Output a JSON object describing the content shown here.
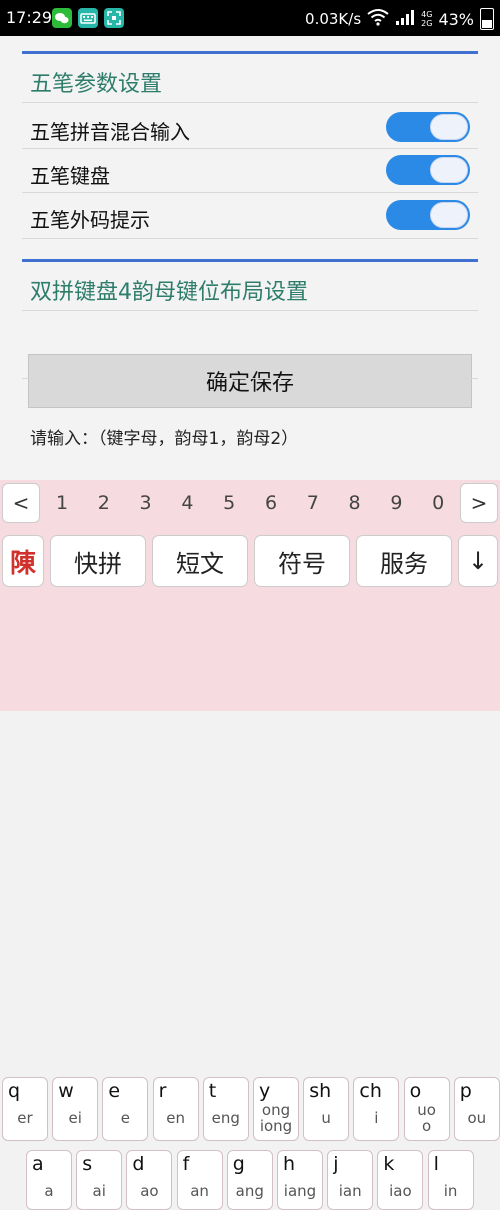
{
  "status_bar": {
    "time": "17:29",
    "speed": "0.03K/s",
    "signal_small": "4G\n2G",
    "battery": "43%",
    "icons": [
      "wechat-icon",
      "keyboard-notify-icon",
      "scan-icon",
      "wifi-icon",
      "signal-icon",
      "battery-icon"
    ]
  },
  "settings": {
    "section1_title": "五笔参数设置",
    "rows": [
      {
        "label": "五笔拼音混合输入",
        "on": true
      },
      {
        "label": "五笔键盘",
        "on": true
      },
      {
        "label": "五笔外码提示",
        "on": true
      }
    ],
    "section2_title": "双拼键盘4韵母键位布局设置",
    "save_label": "确定保存",
    "hint": "请输入：（键字母，韵母1，韵母2）"
  },
  "keyboard": {
    "prev": "<",
    "next": ">",
    "numbers": [
      "1",
      "2",
      "3",
      "4",
      "5",
      "6",
      "7",
      "8",
      "9",
      "0"
    ],
    "logo": "陳",
    "func": [
      "快拼",
      "短文",
      "符号",
      "服务"
    ],
    "collapse": "↓",
    "row1": [
      {
        "k": "q",
        "s": "er"
      },
      {
        "k": "w",
        "s": "ei"
      },
      {
        "k": "e",
        "s": "e"
      },
      {
        "k": "r",
        "s": "en"
      },
      {
        "k": "t",
        "s": "eng"
      },
      {
        "k": "y",
        "s": "ong\niong"
      },
      {
        "k": "sh",
        "s": "u"
      },
      {
        "k": "ch",
        "s": "i"
      },
      {
        "k": "o",
        "s": "uo\no"
      },
      {
        "k": "p",
        "s": "ou"
      }
    ],
    "row2": [
      {
        "k": "a",
        "s": "a"
      },
      {
        "k": "s",
        "s": "ai"
      },
      {
        "k": "d",
        "s": "ao"
      },
      {
        "k": "f",
        "s": "an"
      },
      {
        "k": "g",
        "s": "ang"
      },
      {
        "k": "h",
        "s": "iang"
      },
      {
        "k": "j",
        "s": "ian"
      },
      {
        "k": "k",
        "s": "iao"
      },
      {
        "k": "l",
        "s": "in"
      }
    ]
  }
}
